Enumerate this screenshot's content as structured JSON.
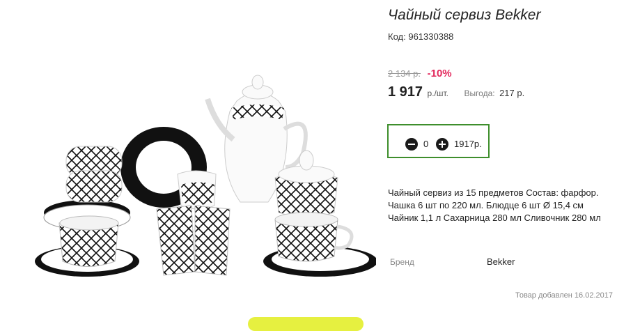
{
  "product": {
    "title": "Чайный сервиз Bekker",
    "code_label": "Код:",
    "code": "961330388",
    "old_price": "2 134 р.",
    "discount": "-10%",
    "price": "1 917",
    "price_unit": "р./шт.",
    "savings_label": "Выгода:",
    "savings_value": "217 р.",
    "description": "Чайный сервиз из 15 предметов Состав: фарфор. Чашка 6 шт по 220 мл. Блюдце 6 шт Ø 15,4 см Чайник 1,1 л Сахарница 280 мл Сливочник 280 мл",
    "brand_label": "Бренд",
    "brand_value": "Bekker",
    "added_date": "Товар добавлен 16.02.2017",
    "image_icon": "tea-set-image"
  },
  "cart": {
    "quantity": "0",
    "total": "1917р.",
    "minus_icon": "minus-circle-icon",
    "plus_icon": "plus-circle-icon"
  },
  "colors": {
    "accent_green": "#3e8e2c",
    "discount_red": "#e2275b",
    "button_yellow": "#e6f040"
  }
}
